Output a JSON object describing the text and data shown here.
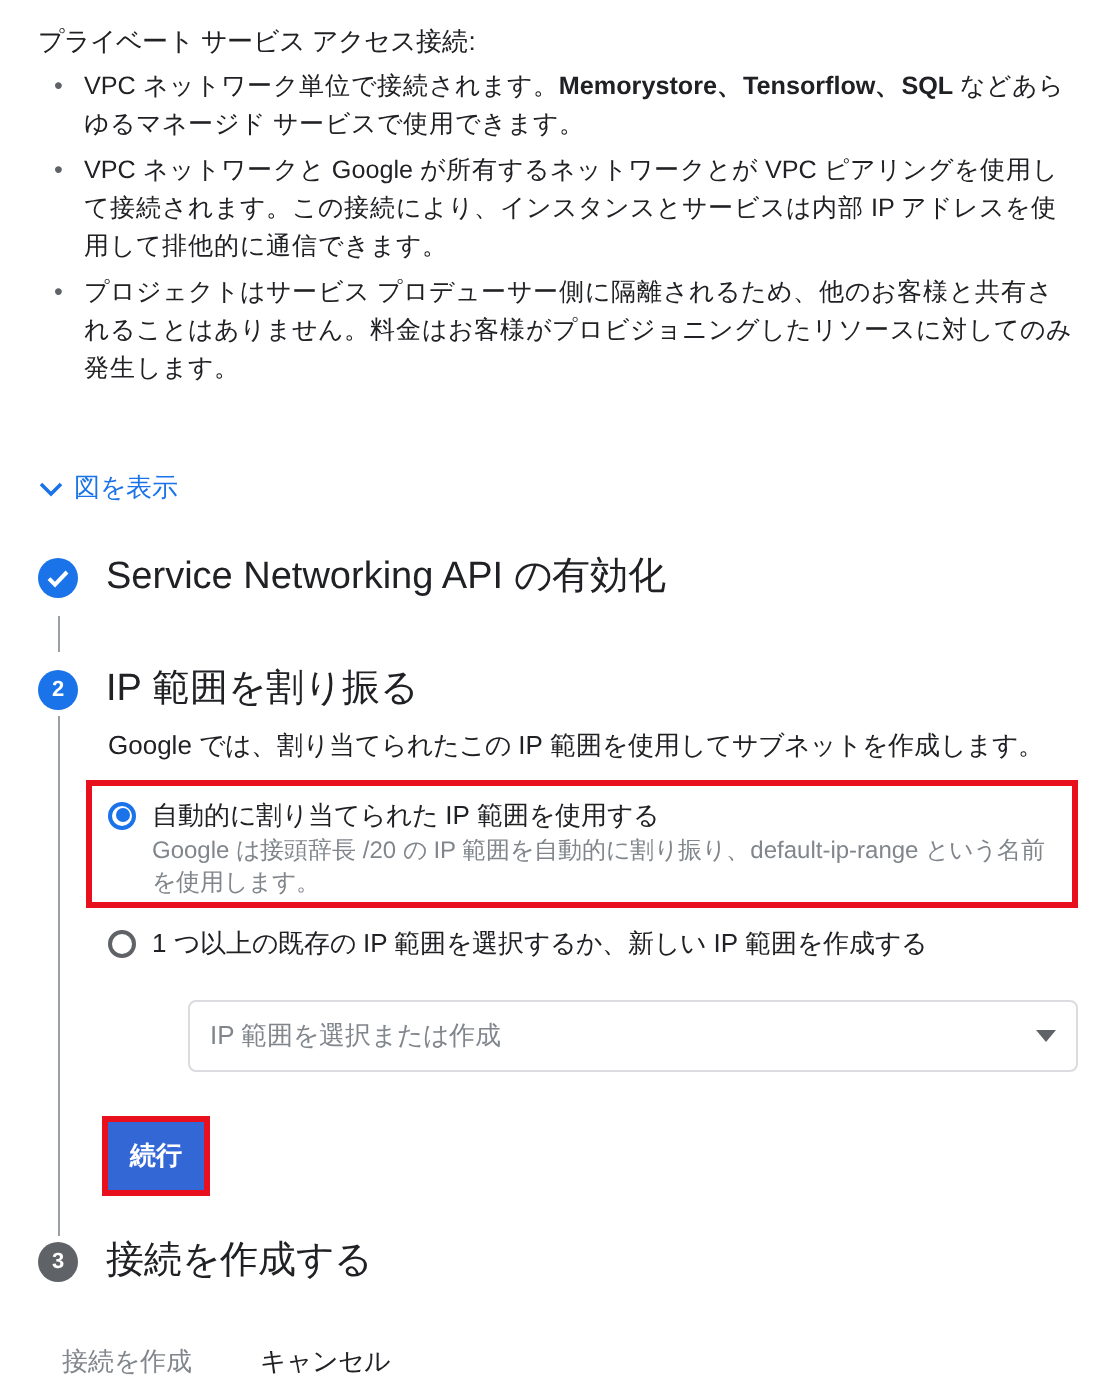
{
  "intro": {
    "title": "プライベート サービス アクセス接続:",
    "bullets": [
      {
        "marker": "•",
        "text": "VPC ネットワーク単位で接続されます。**Memorystore、Tensorflow、SQL** などあらゆるマネージド サービスで使用できます。"
      },
      {
        "marker": "•",
        "text": "VPC ネットワークと Google が所有するネットワークとが VPC ピアリングを使用して接続されます。この接続により、インスタンスとサービスは内部 IP アドレスを使用して排他的に通信できます。"
      },
      {
        "marker": "•",
        "text": "プロジェクトはサービス プロデューサー側に隔離されるため、他のお客様と共有されることはありません。料金はお客様がプロビジョニングしたリソースに対してのみ発生します。"
      }
    ]
  },
  "diagram_toggle": {
    "label": "図を表示",
    "expanded": false
  },
  "steps": [
    {
      "kind": "done",
      "title": "Service Networking API の有効化"
    },
    {
      "kind": "active",
      "number": "2",
      "title": "IP 範囲を割り振る",
      "description": "Google では、割り当てられたこの IP 範囲を使用してサブネットを作成します。",
      "options": [
        {
          "label": "自動的に割り当てられた IP 範囲を使用する",
          "hint": "Google は接頭辞長 /20 の IP 範囲を自動的に割り振り、default-ip-range という名前を使用します。",
          "selected": true,
          "highlighted": true
        },
        {
          "label": "1 つ以上の既存の IP 範囲を選択するか、新しい IP 範囲を作成する",
          "selected": false,
          "highlighted": false
        }
      ],
      "select": {
        "placeholder": "IP 範囲を選択または作成",
        "disabled": true
      },
      "continue_button": {
        "label": "続行",
        "highlighted": true
      }
    },
    {
      "kind": "pending",
      "number": "3",
      "title": "接続を作成する"
    }
  ],
  "footer": {
    "buttons": [
      {
        "label": "接続を作成",
        "disabled": true
      },
      {
        "label": "キャンセル",
        "disabled": false
      }
    ]
  }
}
